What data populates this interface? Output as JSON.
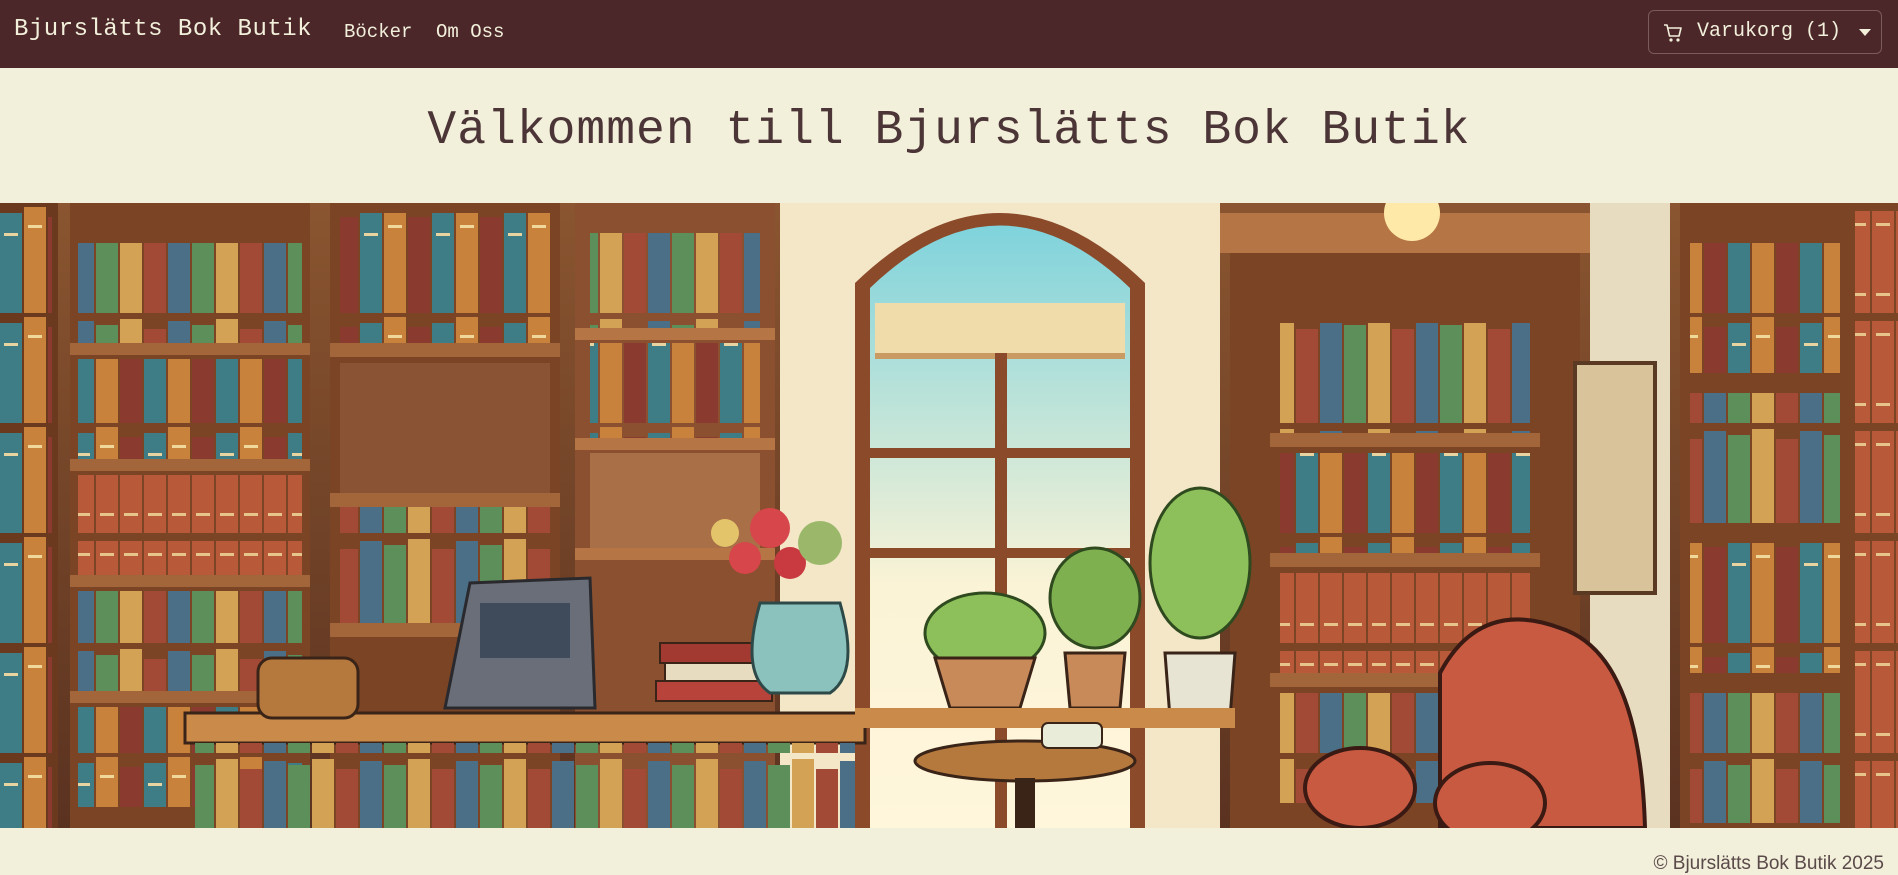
{
  "navbar": {
    "brand": "Bjurslätts Bok Butik",
    "links": [
      "Böcker",
      "Om Oss"
    ],
    "cart_label": "Varukorg (1)",
    "cart_icon": "shopping-cart-icon",
    "caret_icon": "caret-down-icon"
  },
  "hero": {
    "title": "Välkommen till Bjurslätts Bok Butik"
  },
  "banner": {
    "image": "illustrated-bookstore-interior"
  },
  "footer": {
    "copyright": "© Bjurslätts Bok Butik 2025"
  },
  "colors": {
    "navbar_bg": "#4b272a",
    "page_bg": "#f2efda",
    "nav_text": "#f2efda",
    "title_text": "#4b3537"
  }
}
